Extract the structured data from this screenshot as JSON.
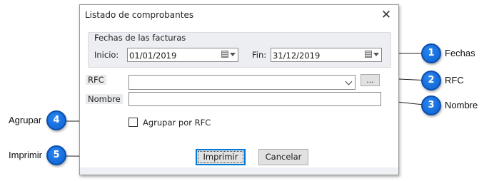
{
  "dialog": {
    "title": "Listado de comprobantes",
    "close_glyph": "✕",
    "fechas_group": {
      "title": "Fechas de las facturas",
      "inicio_label": "Inicio:",
      "inicio_value": "01/01/2019",
      "fin_label": "Fin:",
      "fin_value": "31/12/2019"
    },
    "rfc_label": "RFC",
    "rfc_value": "",
    "rfc_browse_label": "...",
    "nombre_label": "Nombre",
    "nombre_value": "",
    "agrupar_checkbox_label": "Agrupar por RFC",
    "agrupar_checked": false,
    "imprimir_button": "Imprimir",
    "cancelar_button": "Cancelar"
  },
  "callouts": [
    {
      "number": "1",
      "label": "Fechas"
    },
    {
      "number": "2",
      "label": "RFC"
    },
    {
      "number": "3",
      "label": "Nombre"
    },
    {
      "number": "4",
      "label": "Agrupar"
    },
    {
      "number": "5",
      "label": "Imprimir"
    }
  ],
  "colors": {
    "callout_blue": "#0b5fd0",
    "default_button_border": "#0078d7",
    "group_background": "#eceef2"
  }
}
